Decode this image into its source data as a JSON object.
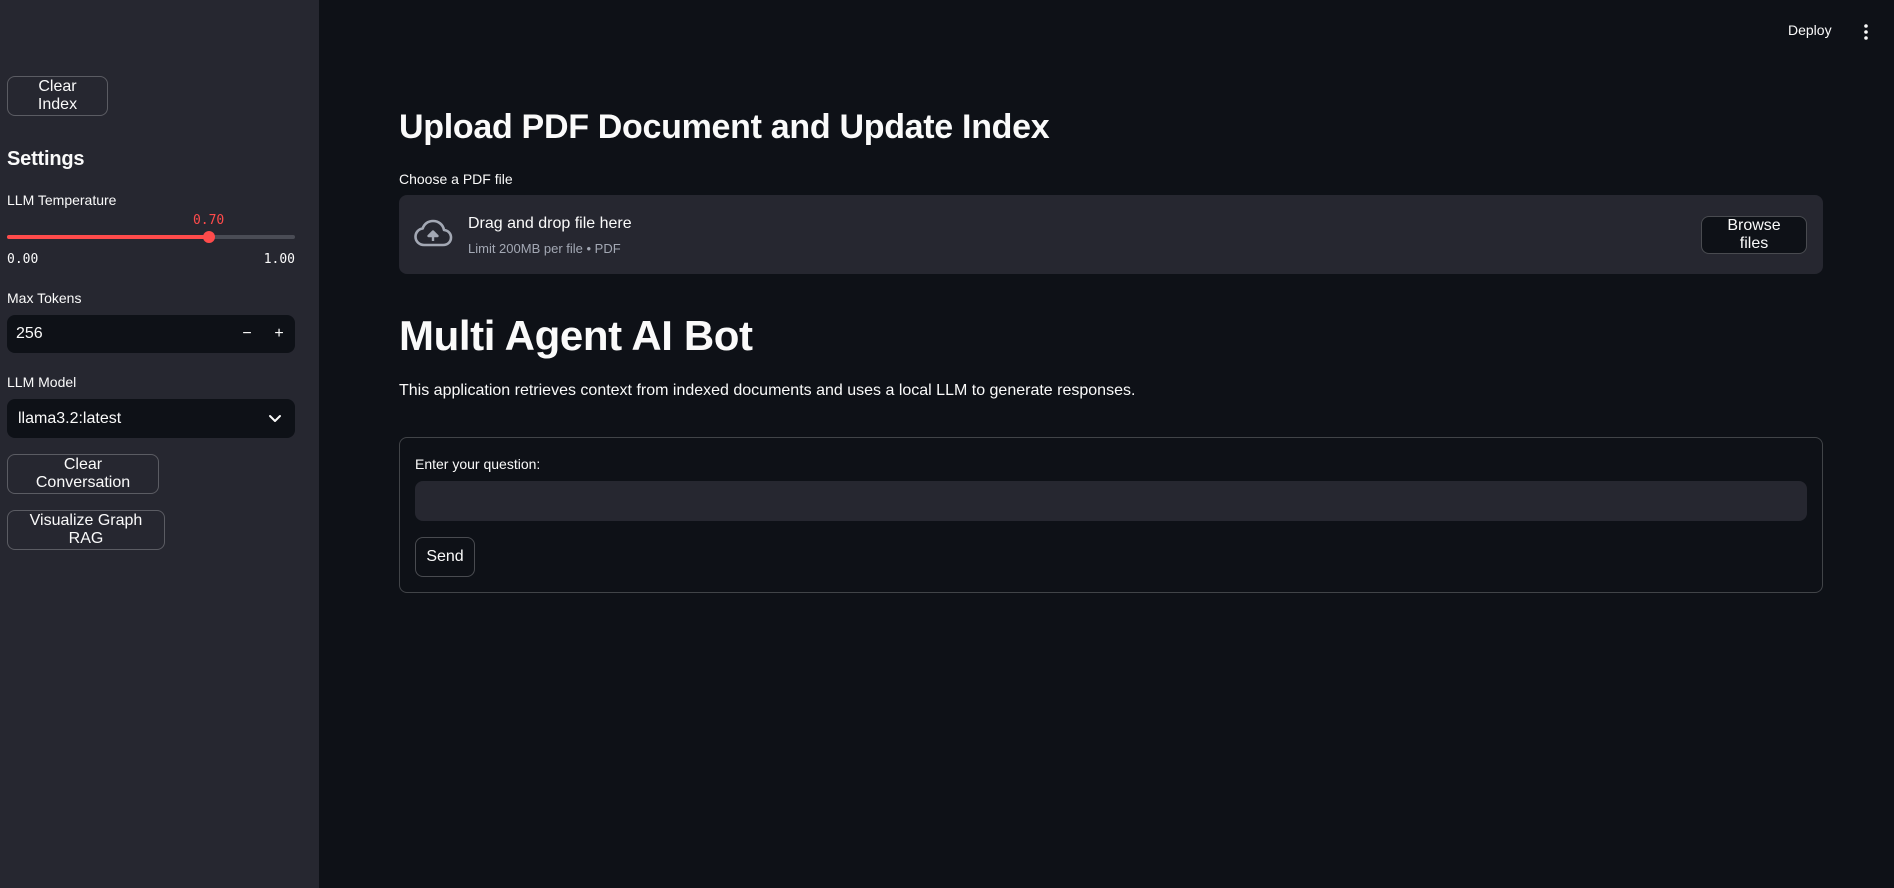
{
  "header": {
    "deploy_label": "Deploy"
  },
  "sidebar": {
    "clear_index_label": "Clear Index",
    "settings_heading": "Settings",
    "temperature": {
      "label": "LLM Temperature",
      "value": 0.7,
      "value_text": "0.70",
      "min": 0.0,
      "max": 1.0,
      "min_text": "0.00",
      "max_text": "1.00"
    },
    "max_tokens": {
      "label": "Max Tokens",
      "value": "256",
      "decrement_symbol": "−",
      "increment_symbol": "+"
    },
    "llm_model": {
      "label": "LLM Model",
      "selected": "llama3.2:latest"
    },
    "clear_conversation_label": "Clear Conversation",
    "visualize_label": "Visualize Graph RAG"
  },
  "main": {
    "upload_title": "Upload PDF Document and Update Index",
    "file_label": "Choose a PDF file",
    "dropzone_title": "Drag and drop file here",
    "dropzone_subtitle": "Limit 200MB per file • PDF",
    "browse_label": "Browse files",
    "bot_title": "Multi Agent AI Bot",
    "description": "This application retrieves context from indexed documents and uses a local LLM to generate responses.",
    "question_label": "Enter your question:",
    "question_value": "",
    "send_label": "Send"
  },
  "colors": {
    "background": "#0e1117",
    "sidebar": "#262730",
    "accent": "#ff4b4b",
    "text": "#fafafa",
    "muted_text": "#a3a8b4"
  },
  "icons": {
    "kebab": "vertical-dots-icon",
    "upload": "cloud-upload-icon",
    "select_chevron": "chevron-down-icon"
  }
}
